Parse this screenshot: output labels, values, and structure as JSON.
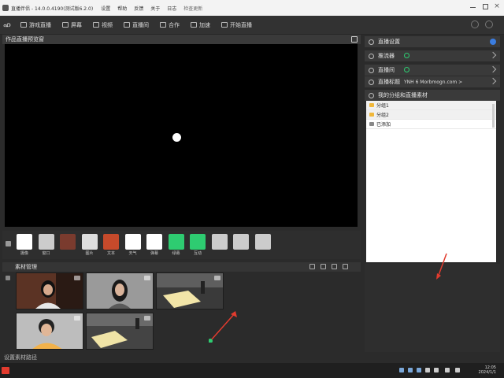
{
  "window": {
    "title": "直播伴侣 - 14.0.0.4190(测试版6.2.0)",
    "menus": [
      "设置",
      "帮助",
      "反馈",
      "关于",
      "日志"
    ],
    "sub_menu": "检查更新"
  },
  "toolbar": {
    "logo": "ഹ",
    "tabs": [
      "游戏直播",
      "屏幕",
      "视频",
      "直播间",
      "合作",
      "加速",
      "开始直播"
    ]
  },
  "preview": {
    "label": "作品直播预览窗"
  },
  "sources": [
    {
      "label": "摄像",
      "color": "#ffffff"
    },
    {
      "label": "窗口",
      "color": "#cccccc"
    },
    {
      "label": "",
      "color": "#7a3b2e"
    },
    {
      "label": "图片",
      "color": "#dddddd"
    },
    {
      "label": "文本",
      "color": "#c64a2b"
    },
    {
      "label": "天气",
      "color": "#ffffff"
    },
    {
      "label": "弹幕",
      "color": "#ffffff"
    },
    {
      "label": "绿幕",
      "color": "#2ecc71"
    },
    {
      "label": "互动",
      "color": "#2ecc71"
    },
    {
      "label": "",
      "color": "#cccccc"
    },
    {
      "label": "",
      "color": "#cccccc"
    },
    {
      "label": "",
      "color": "#cccccc"
    }
  ],
  "media": {
    "label": "素材管理",
    "status": "设置素材路径",
    "items": [
      {
        "name": "person-woman-1",
        "bg": "#6e3e2a"
      },
      {
        "name": "person-woman-2",
        "bg": "#8a8a8a"
      },
      {
        "name": "desk-scene-1",
        "bg": "#2d2d2d"
      },
      {
        "name": "person-man-1",
        "bg": "#b9b9b9"
      },
      {
        "name": "desk-scene-2",
        "bg": "#3a3a3a"
      }
    ]
  },
  "right_panel": {
    "rows": [
      {
        "label": "直播设置",
        "value": ""
      },
      {
        "label": "推流器",
        "value": ""
      },
      {
        "label": "直播间",
        "value": ""
      },
      {
        "label": "直播标题",
        "value": "YNH 6 Morbmogn.com >"
      }
    ],
    "list_header": "我的分组和直播素材",
    "list_items": [
      "分组1",
      "分组2",
      "已添加"
    ]
  },
  "taskbar": {
    "time": "12:05",
    "date": "2024/1/1"
  }
}
